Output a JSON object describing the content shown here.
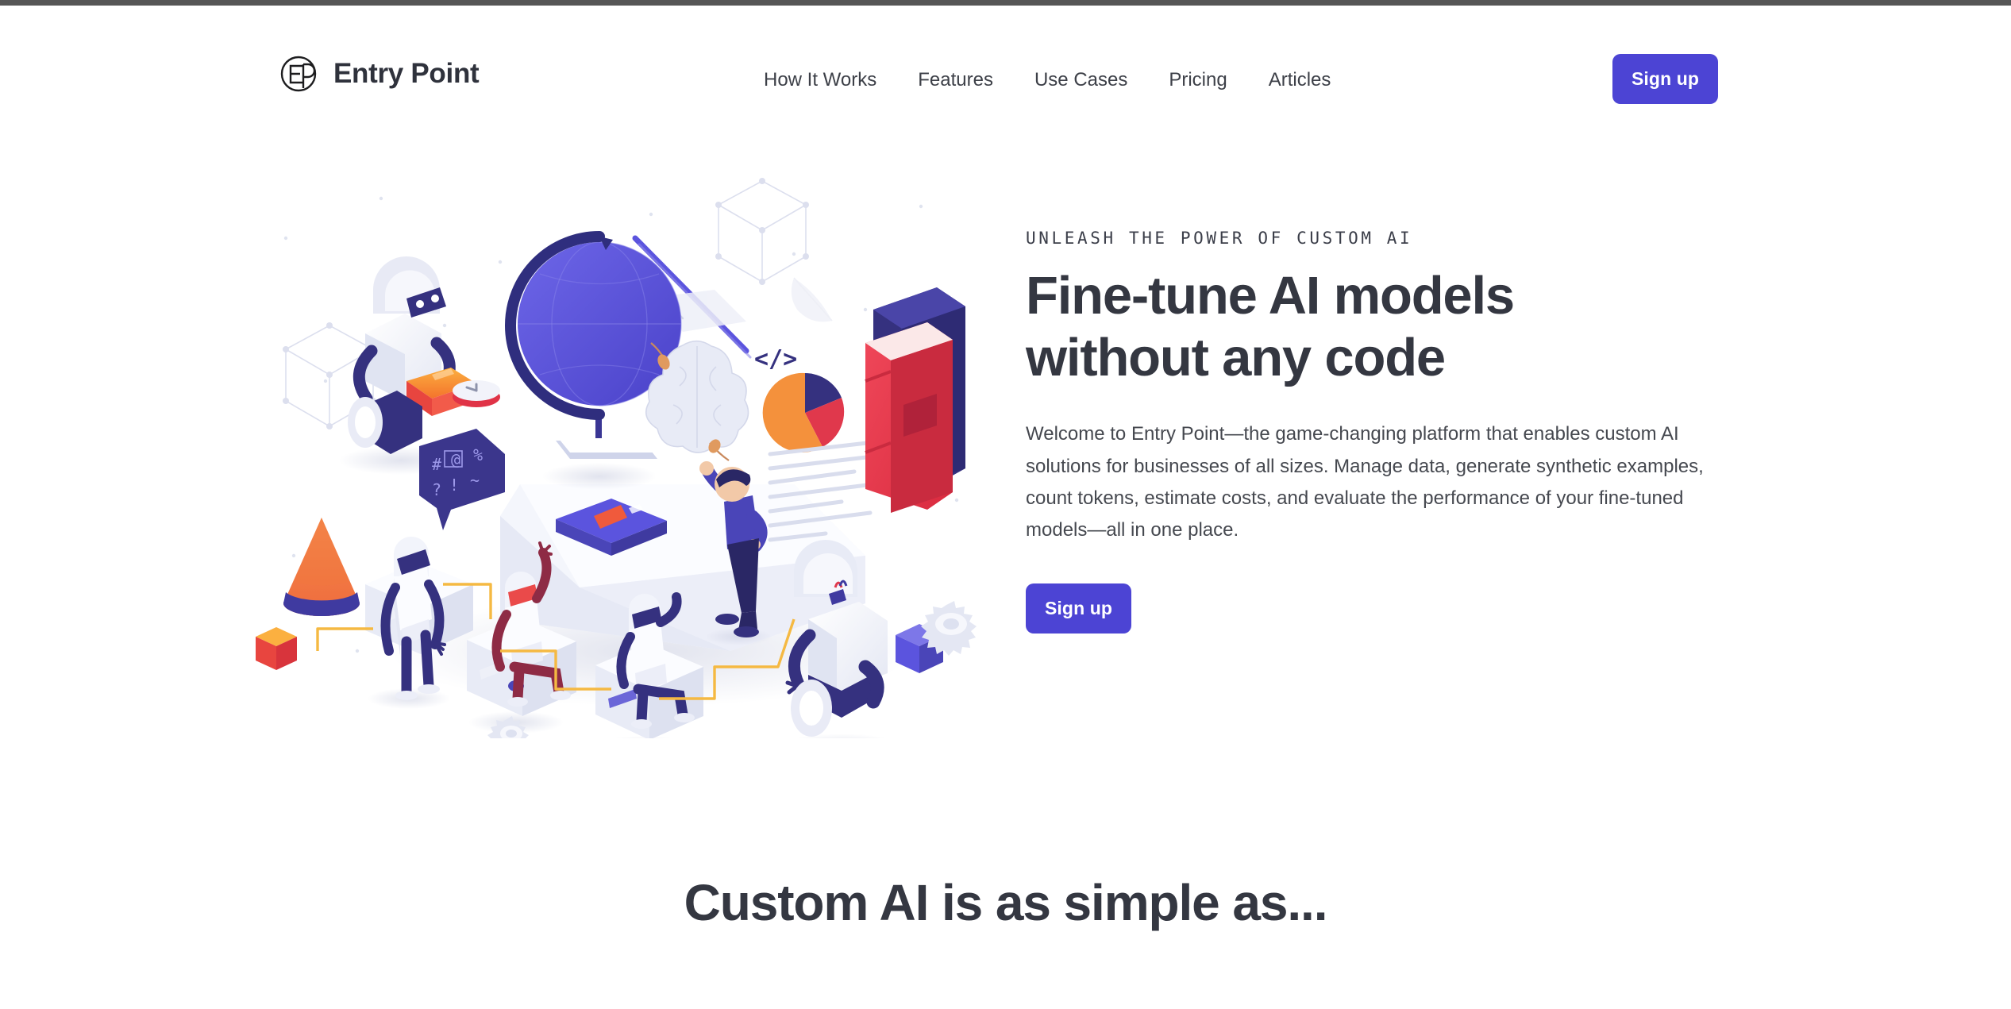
{
  "brand": {
    "name": "Entry Point",
    "logo_icon": "ep-monogram-circle-icon"
  },
  "nav": {
    "items": [
      {
        "label": "How It Works"
      },
      {
        "label": "Features"
      },
      {
        "label": "Use Cases"
      },
      {
        "label": "Pricing"
      },
      {
        "label": "Articles"
      }
    ],
    "cta_label": "Sign up"
  },
  "hero": {
    "eyebrow": "UNLEASH THE POWER OF CUSTOM AI",
    "title_line1": "Fine-tune AI models",
    "title_line2": "without any code",
    "description": "Welcome to Entry Point—the game-changing platform that enables custom AI solutions for businesses of all sizes. Manage data, generate synthetic examples, count tokens, estimate costs, and evaluate the performance of your fine-tuned models—all in one place.",
    "cta_label": "Sign up",
    "illustration_name": "isometric-ai-robots-workspace-illustration"
  },
  "simple_section": {
    "title": "Custom AI is as simple as..."
  },
  "colors": {
    "accent": "#4c44d4",
    "heading": "#343741",
    "body_text": "#45484f",
    "illustration_purple": "#5b54de",
    "illustration_deep_purple": "#2f2e7e",
    "illustration_red": "#ea3a4b",
    "illustration_orange": "#f79433",
    "illustration_light": "#eceef7",
    "wire_orange": "#f5b942",
    "page_background": "#ffffff"
  }
}
